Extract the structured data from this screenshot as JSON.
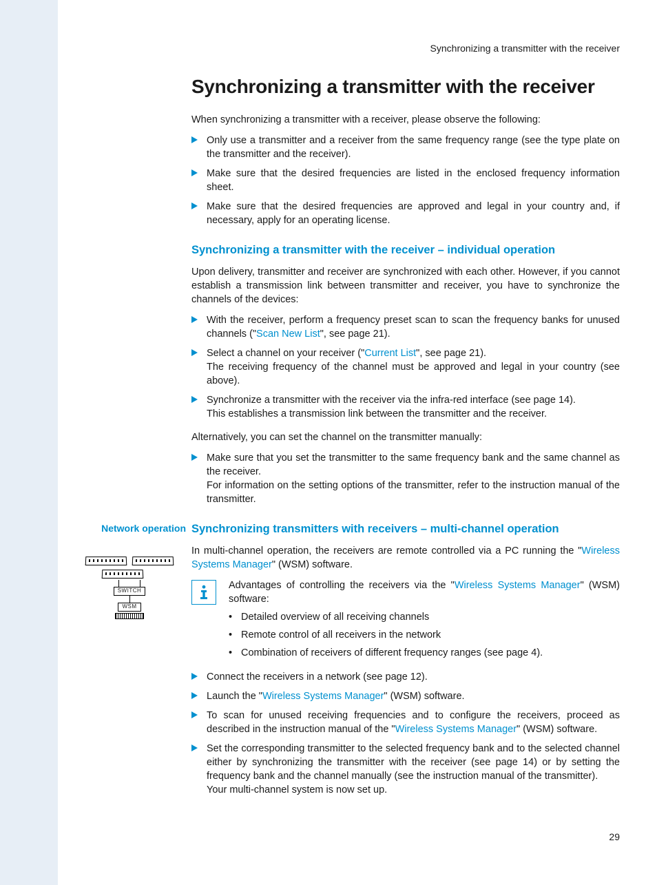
{
  "header": {
    "running_title": "Synchronizing a transmitter with the receiver"
  },
  "page_number": "29",
  "title": "Synchronizing a transmitter with the receiver",
  "intro": "When synchronizing a transmitter with a receiver, please observe the following:",
  "intro_bullets": [
    "Only use a transmitter and a receiver from the same frequency range (see the type plate on the transmitter and the receiver).",
    "Make sure that the desired frequencies are listed in the enclosed frequency information sheet.",
    "Make sure that the desired frequencies are approved and legal in your country and, if necessary, apply for an operating license."
  ],
  "section_individual": {
    "heading": "Synchronizing a transmitter with the receiver – individual operation",
    "p1": "Upon delivery, transmitter and receiver are synchronized with each other. However, if you cannot establish a transmission link between transmitter and receiver, you have to synchronize the channels of the devices:",
    "bullets": [
      {
        "pre": "With the receiver, perform a frequency preset scan to scan the frequency banks for unused channels (\"",
        "link": "Scan New List",
        "post": "\", see page 21)."
      },
      {
        "pre": "Select a channel on your receiver (\"",
        "link": "Current List",
        "post": "\", see page 21).",
        "tail": "The receiving frequency of the channel must be approved and legal in your country (see above)."
      },
      {
        "pre": "Synchronize a transmitter with the receiver via the infra-red interface (see page 14).",
        "link": "",
        "post": "",
        "tail": "This establishes a transmission link between the transmitter and the receiver."
      }
    ],
    "alt": "Alternatively, you can set the channel on the transmitter manually:",
    "alt_bullet": "Make sure that you set the transmitter to the same frequency bank and the same channel as the receiver.",
    "alt_bullet_tail": "For information on the setting options of the transmitter, refer to the instruction manual of the transmitter."
  },
  "margin": {
    "network_operation": "Network operation",
    "switch": "SWITCH",
    "wsm": "WSM"
  },
  "section_multi": {
    "heading": "Synchronizing transmitters with receivers – multi-channel operation",
    "p1_pre": "In multi-channel operation, the receivers are remote controlled via a PC running the \"",
    "p1_link": "Wireless Systems Manager",
    "p1_post": "\" (WSM) software.",
    "info_pre": "Advantages of controlling the receivers via the \"",
    "info_link": "Wireless Systems Manager",
    "info_post": "\" (WSM) software:",
    "info_items": [
      "Detailed overview of all receiving channels",
      "Remote control of all receivers in the network",
      "Combination of receivers of different frequency ranges (see page 4)."
    ],
    "steps": [
      {
        "pre": "Connect the receivers in a network (see page 12).",
        "link": "",
        "post": ""
      },
      {
        "pre": "Launch the \"",
        "link": "Wireless Systems Manager",
        "post": "\" (WSM) software."
      },
      {
        "pre": "To scan for unused receiving frequencies and to configure the receivers, proceed as described in the instruction manual of the \"",
        "link": "Wireless Systems Manager",
        "post": "\" (WSM) software."
      },
      {
        "pre": "Set the corresponding transmitter to the selected frequency bank and to the selected channel either by synchronizing the transmitter with the receiver (see page 14) or by setting the frequency bank and the channel manually (see the instruction manual of the transmitter).",
        "link": "",
        "post": "",
        "tail": "Your multi-channel system is now set up."
      }
    ]
  }
}
